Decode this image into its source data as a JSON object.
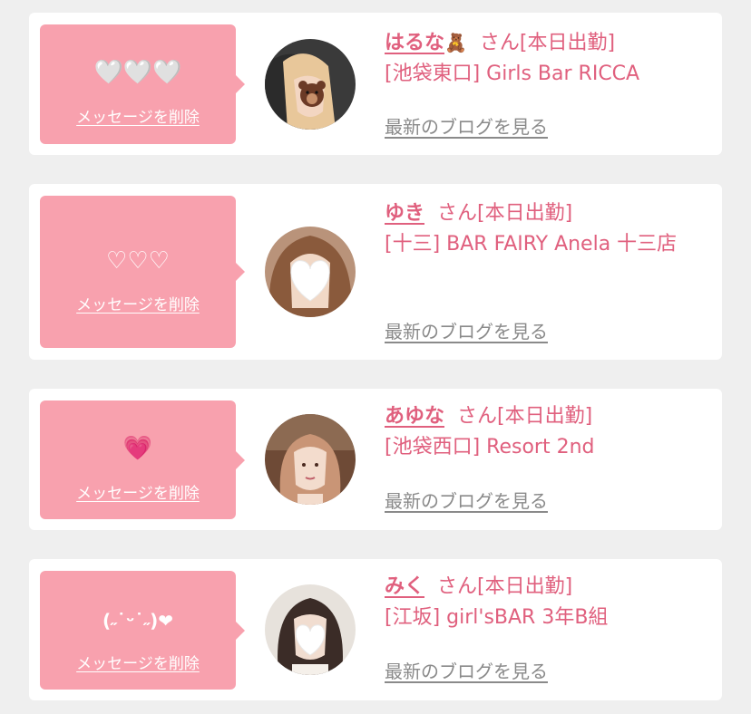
{
  "common": {
    "delete_label": "メッセージを削除",
    "san_label": "さん[本日出勤]",
    "blog_label": "最新のブログを見る"
  },
  "colors": {
    "background": "#efefef",
    "card": "#ffffff",
    "bubble": "#f8a1ae",
    "accent": "#e0607e",
    "link_gray": "#8a8a8a"
  },
  "cards": [
    {
      "message": "🤍🤍🤍",
      "name": "はるな",
      "name_emoji": "🧸",
      "shop": "[池袋東口] Girls Bar RICCA",
      "avatar_icon": "bear-sticker-icon"
    },
    {
      "message": "♡♡♡",
      "name": "ゆき",
      "name_emoji": "",
      "shop": "[十三] BAR FAIRY Anela 十三店",
      "avatar_icon": "heart-sticker-icon"
    },
    {
      "message": "💗",
      "name": "あゆな",
      "name_emoji": "",
      "shop": "[池袋西口] Resort 2nd",
      "avatar_icon": "photo-icon"
    },
    {
      "message": "(˶˙ᵕ˙˶)❤",
      "name": "みく",
      "name_emoji": "",
      "shop": "[江坂] girl'sBAR 3年B組",
      "avatar_icon": "heart-sticker-icon"
    }
  ]
}
